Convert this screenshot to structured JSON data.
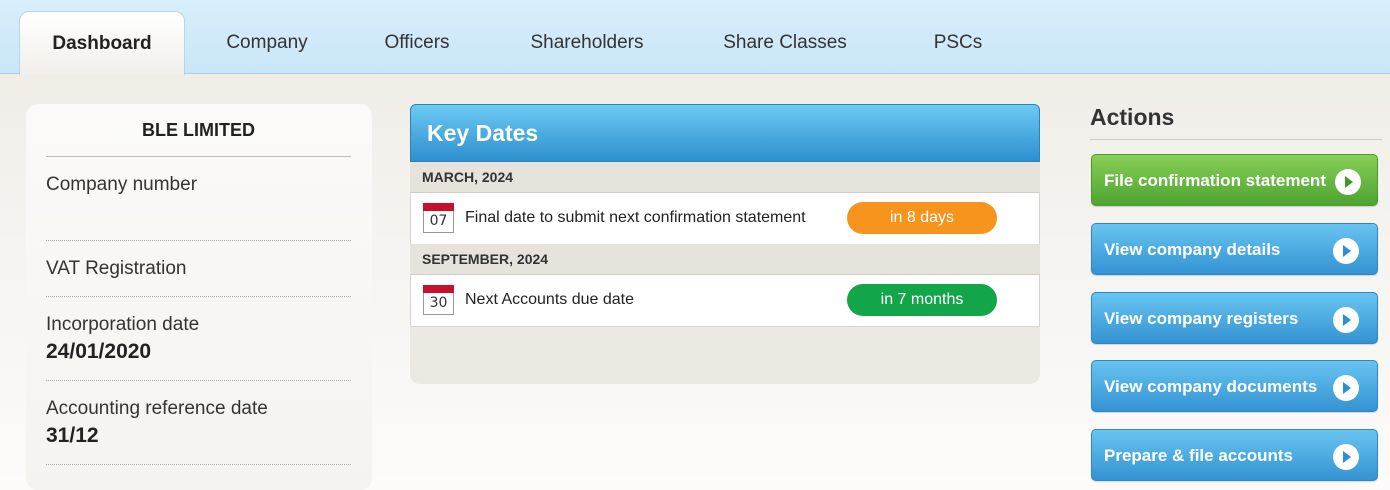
{
  "tabs": [
    {
      "label": "Dashboard",
      "active": true
    },
    {
      "label": "Company",
      "active": false
    },
    {
      "label": "Officers",
      "active": false
    },
    {
      "label": "Shareholders",
      "active": false
    },
    {
      "label": "Share Classes",
      "active": false
    },
    {
      "label": "PSCs",
      "active": false
    }
  ],
  "company": {
    "name": "BLE LIMITED",
    "fields": [
      {
        "label": "Company number",
        "value": ""
      },
      {
        "label": "VAT Registration",
        "value": ""
      },
      {
        "label": "Incorporation date",
        "value": "24/01/2020"
      },
      {
        "label": "Accounting reference date",
        "value": "31/12"
      }
    ]
  },
  "key_dates": {
    "title": "Key Dates",
    "groups": [
      {
        "month": "MARCH, 2024",
        "items": [
          {
            "day": "07",
            "text": "Final date to submit next confirmation statement",
            "badge": "in 8 days",
            "badge_color": "#f7941d"
          }
        ]
      },
      {
        "month": "SEPTEMBER, 2024",
        "items": [
          {
            "day": "30",
            "text": "Next Accounts due date",
            "badge": "in 7 months",
            "badge_color": "#13a54a"
          }
        ]
      }
    ]
  },
  "actions": {
    "title": "Actions",
    "buttons": [
      {
        "label": "File confirmation statement",
        "color": "green",
        "icon": "play-circle-icon"
      },
      {
        "label": "View company details",
        "color": "blue",
        "icon": "play-circle-icon"
      },
      {
        "label": "View company registers",
        "color": "blue",
        "icon": "play-circle-icon"
      },
      {
        "label": "View company documents",
        "color": "blue",
        "icon": "play-circle-icon"
      },
      {
        "label": "Prepare & file accounts",
        "color": "blue",
        "icon": "play-circle-icon"
      }
    ]
  },
  "colors": {
    "tab_bar": "#c9e6f8",
    "key_dates_header": "#2d8fcf",
    "action_blue": "#3493d3",
    "action_green": "#4ea332",
    "calendar_red": "#c8102e"
  }
}
